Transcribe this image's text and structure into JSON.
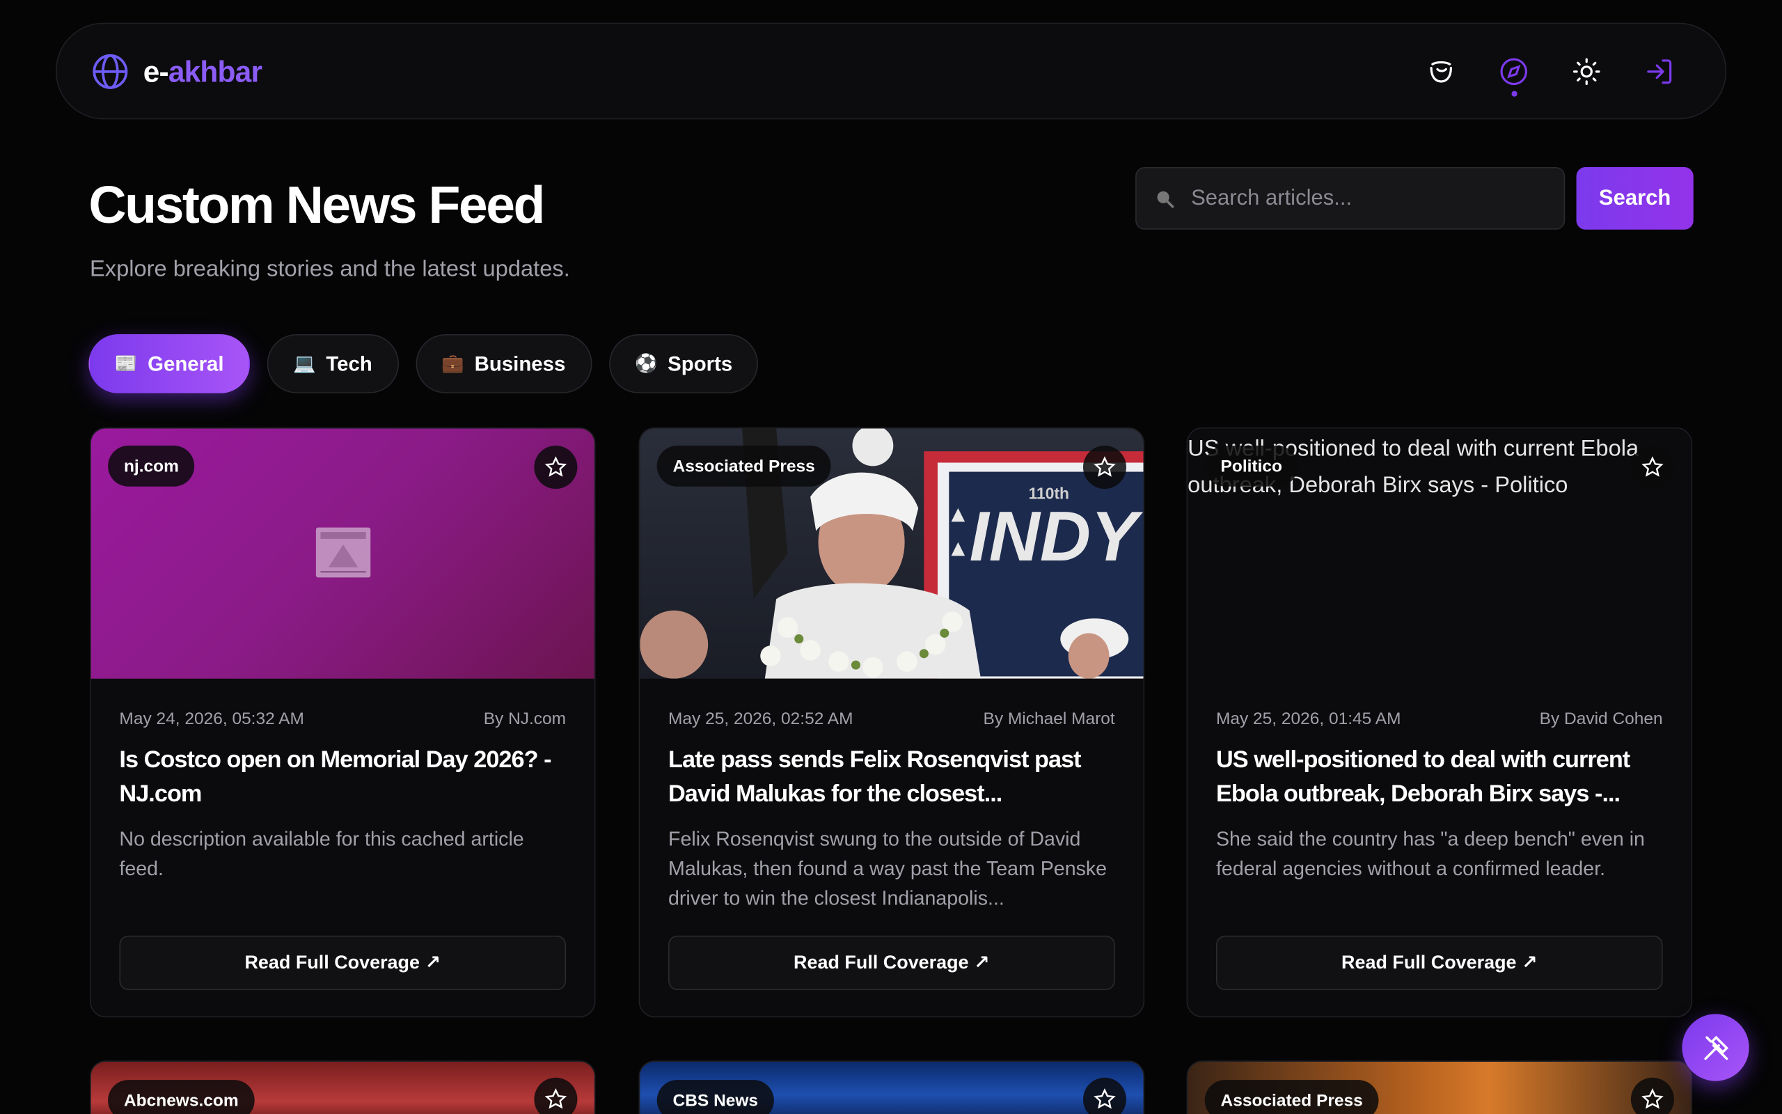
{
  "brand": {
    "name_part1": "e-",
    "name_part2": "akhbar"
  },
  "nav": {
    "icons": [
      "chef-hat-icon",
      "compass-icon",
      "sun-icon",
      "login-icon"
    ]
  },
  "header": {
    "title": "Custom News Feed",
    "subtitle": "Explore breaking stories and the latest updates."
  },
  "search": {
    "placeholder": "Search articles...",
    "button_label": "Search"
  },
  "tabs": [
    {
      "emoji": "📰",
      "label": "General",
      "active": true
    },
    {
      "emoji": "💻",
      "label": "Tech",
      "active": false
    },
    {
      "emoji": "💼",
      "label": "Business",
      "active": false
    },
    {
      "emoji": "⚽",
      "label": "Sports",
      "active": false
    }
  ],
  "articles": [
    {
      "source": "nj.com",
      "date": "May 24, 2026, 05:32 AM",
      "author": "By NJ.com",
      "title": "Is Costco open on Memorial Day 2026? - NJ.com",
      "description": "No description available for this cached article feed.",
      "read_label": "Read Full Coverage ↗"
    },
    {
      "source": "Associated Press",
      "date": "May 25, 2026, 02:52 AM",
      "author": "By Michael Marot",
      "title": "Late pass sends Felix Rosenqvist past David Malukas for the closest...",
      "description": "Felix Rosenqvist swung to the outside of David Malukas, then found a way past the Team Penske driver to win the closest Indianapolis...",
      "read_label": "Read Full Coverage ↗"
    },
    {
      "source": "Politico",
      "image_alt": "US well-positioned to deal with current Ebola outbreak, Deborah Birx says - Politico",
      "date": "May 25, 2026, 01:45 AM",
      "author": "By David Cohen",
      "title": "US well-positioned to deal with current Ebola outbreak, Deborah Birx says -...",
      "description": "She said the country has \"a deep bench\" even in federal agencies without a confirmed leader.",
      "read_label": "Read Full Coverage ↗"
    }
  ],
  "next_row_sources": [
    "Abcnews.com",
    "CBS News",
    "Associated Press"
  ],
  "image_text": {
    "indy_banner": "INDY",
    "indy_year": "110th"
  },
  "colors": {
    "accent": "#7c3aed",
    "accent_light": "#a855f7",
    "background": "#050506",
    "card": "#0b0b0d"
  },
  "fab": {
    "icon": "tools-icon"
  }
}
